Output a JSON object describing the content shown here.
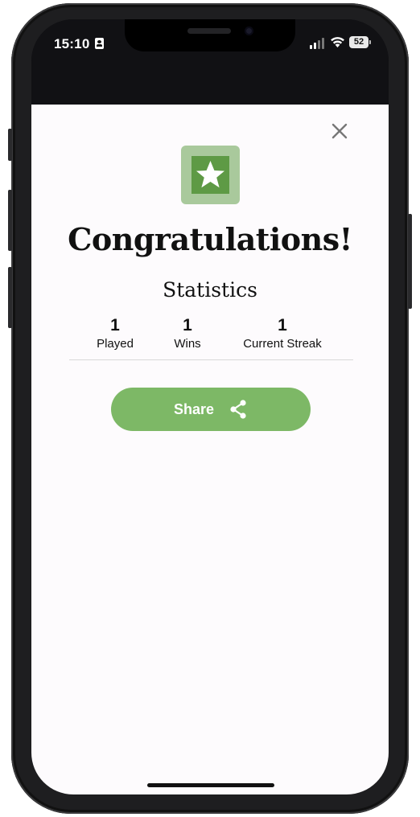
{
  "status_bar": {
    "time": "15:10",
    "battery": "52"
  },
  "dialog": {
    "close_icon": "close-icon",
    "badge_icon": "star-icon",
    "title": "Congratulations!",
    "subtitle": "Statistics",
    "stats": [
      {
        "value": "1",
        "label": "Played"
      },
      {
        "value": "1",
        "label": "Wins"
      },
      {
        "value": "1",
        "label": "Current Streak"
      }
    ],
    "share_label": "Share",
    "share_icon": "share-icon"
  },
  "colors": {
    "accent": "#7db866",
    "star_tile": "#a9c99c",
    "star_inner": "#5e9a45"
  }
}
